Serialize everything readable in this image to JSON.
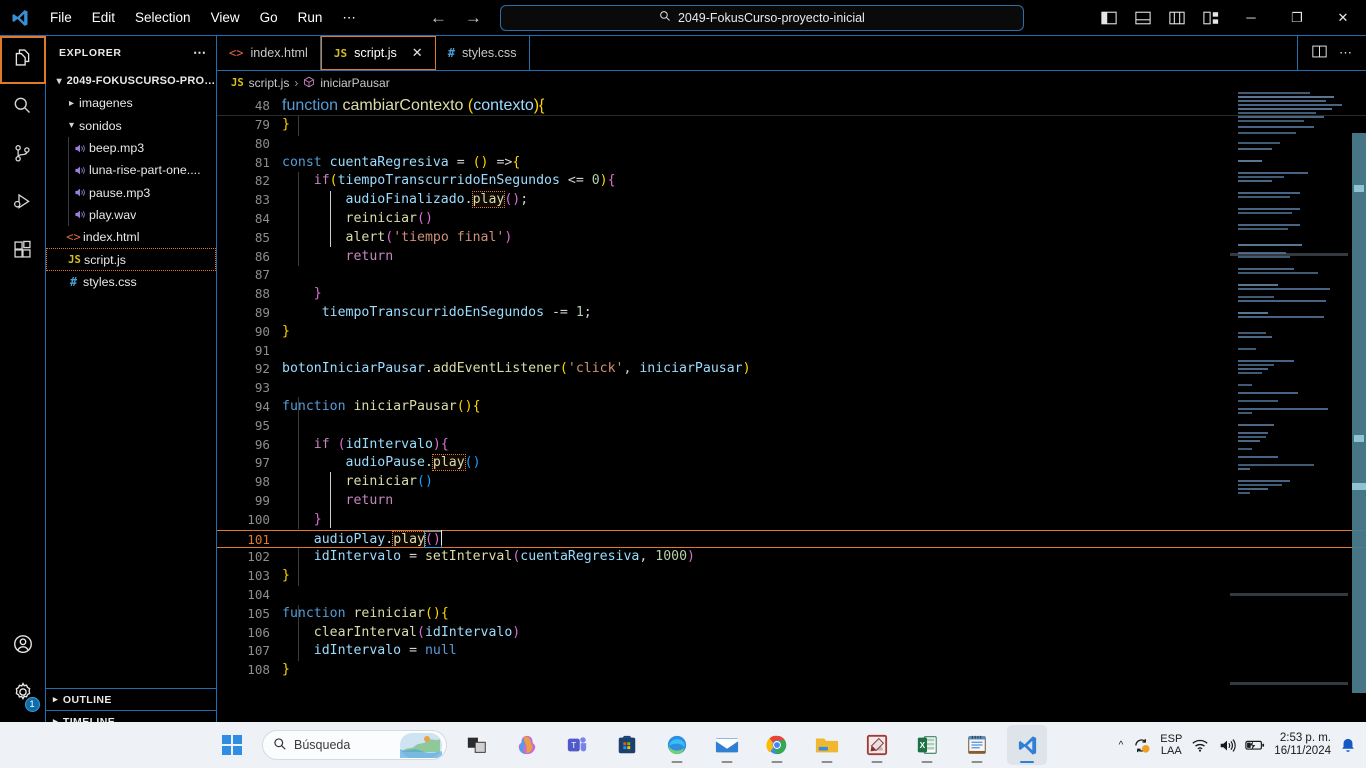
{
  "titlebar": {
    "logo_icon": "vscode-logo-icon",
    "menus": [
      "File",
      "Edit",
      "Selection",
      "View",
      "Go",
      "Run",
      "⋯"
    ],
    "nav_back_icon": "arrow-left-icon",
    "nav_forward_icon": "arrow-right-icon",
    "search": {
      "icon": "search-icon",
      "value": "2049-FokusCurso-proyecto-inicial"
    },
    "layout_buttons": [
      {
        "name": "toggle-primary-sidebar",
        "icon": "panel-left-icon"
      },
      {
        "name": "toggle-panel",
        "icon": "panel-bottom-icon"
      },
      {
        "name": "toggle-secondary-sidebar",
        "icon": "panel-right-icon"
      },
      {
        "name": "customize-layout",
        "icon": "layout-grid-icon"
      }
    ],
    "window_controls": {
      "minimize": "─",
      "restore": "❐",
      "close": "✕"
    }
  },
  "activitybar": {
    "items": [
      {
        "name": "explorer",
        "icon": "files-icon",
        "active": true
      },
      {
        "name": "search",
        "icon": "search-icon",
        "active": false
      },
      {
        "name": "source-control",
        "icon": "source-control-icon",
        "active": false
      },
      {
        "name": "run-and-debug",
        "icon": "run-debug-icon",
        "active": false
      },
      {
        "name": "extensions",
        "icon": "extensions-icon",
        "active": false
      }
    ],
    "bottom": [
      {
        "name": "accounts",
        "icon": "account-icon",
        "badge": ""
      },
      {
        "name": "manage-settings",
        "icon": "gear-icon",
        "badge": "1"
      }
    ]
  },
  "sidebar": {
    "title": "EXPLORER",
    "more_actions_icon": "ellipsis-icon",
    "root": {
      "label": "2049-FOKUSCURSO-PROY...",
      "expanded": true
    },
    "tree": [
      {
        "label": "imagenes",
        "icon": "folder-icon",
        "depth": 1,
        "kind": "folder",
        "expanded": false,
        "selected": false
      },
      {
        "label": "sonidos",
        "icon": "folder-icon",
        "depth": 1,
        "kind": "folder",
        "expanded": true,
        "selected": false
      },
      {
        "label": "beep.mp3",
        "icon": "audio-icon",
        "depth": 2,
        "kind": "file",
        "selected": false
      },
      {
        "label": "luna-rise-part-one....",
        "icon": "audio-icon",
        "depth": 2,
        "kind": "file",
        "selected": false
      },
      {
        "label": "pause.mp3",
        "icon": "audio-icon",
        "depth": 2,
        "kind": "file",
        "selected": false
      },
      {
        "label": "play.wav",
        "icon": "audio-icon",
        "depth": 2,
        "kind": "file",
        "selected": false
      },
      {
        "label": "index.html",
        "icon": "html-icon",
        "depth": 1,
        "kind": "file",
        "selected": false
      },
      {
        "label": "script.js",
        "icon": "js-icon",
        "depth": 1,
        "kind": "file",
        "selected": true
      },
      {
        "label": "styles.css",
        "icon": "css-icon",
        "depth": 1,
        "kind": "file",
        "selected": false
      }
    ],
    "sections": [
      {
        "label": "OUTLINE",
        "icon": "chevron-right-icon"
      },
      {
        "label": "TIMELINE",
        "icon": "chevron-right-icon"
      }
    ]
  },
  "editor": {
    "tabs": [
      {
        "label": "index.html",
        "icon": "html-icon",
        "active": false,
        "closable": false
      },
      {
        "label": "script.js",
        "icon": "js-icon",
        "active": true,
        "closable": true,
        "close_icon": "close-icon"
      },
      {
        "label": "styles.css",
        "icon": "css-icon",
        "active": false,
        "closable": false
      }
    ],
    "tab_actions": [
      {
        "name": "split-editor",
        "icon": "split-editor-icon"
      },
      {
        "name": "more-actions",
        "icon": "ellipsis-icon"
      }
    ],
    "breadcrumb": {
      "file_icon": "js-icon",
      "file": "script.js",
      "separator": "›",
      "symbol_icon": "symbol-method-icon",
      "symbol": "iniciarPausar"
    },
    "sticky_scroll": {
      "line": "48",
      "text": "function cambiarContexto (contexto){"
    },
    "current_line": 101,
    "first_visible_line": 78,
    "lines": [
      {
        "n": "79",
        "text": "}"
      },
      {
        "n": "80",
        "text": ""
      },
      {
        "n": "81",
        "text": "const cuentaRegresiva = () =>{"
      },
      {
        "n": "82",
        "text": "    if(tiempoTranscurridoEnSegundos <= 0){"
      },
      {
        "n": "83",
        "text": "        audioFinalizado.play();"
      },
      {
        "n": "84",
        "text": "        reiniciar()"
      },
      {
        "n": "85",
        "text": "        alert('tiempo final')"
      },
      {
        "n": "86",
        "text": "        return"
      },
      {
        "n": "87",
        "text": ""
      },
      {
        "n": "88",
        "text": "    }"
      },
      {
        "n": "89",
        "text": "     tiempoTranscurridoEnSegundos -= 1;"
      },
      {
        "n": "90",
        "text": "}"
      },
      {
        "n": "91",
        "text": ""
      },
      {
        "n": "92",
        "text": "botonIniciarPausar.addEventListener('click', iniciarPausar)"
      },
      {
        "n": "93",
        "text": ""
      },
      {
        "n": "94",
        "text": "function iniciarPausar(){"
      },
      {
        "n": "95",
        "text": ""
      },
      {
        "n": "96",
        "text": "    if (idIntervalo){"
      },
      {
        "n": "97",
        "text": "        audioPause.play()"
      },
      {
        "n": "98",
        "text": "        reiniciar()"
      },
      {
        "n": "99",
        "text": "        return"
      },
      {
        "n": "100",
        "text": "    }"
      },
      {
        "n": "101",
        "text": "    audioPlay.play()"
      },
      {
        "n": "102",
        "text": "    idIntervalo = setInterval(cuentaRegresiva, 1000)"
      },
      {
        "n": "103",
        "text": "}"
      },
      {
        "n": "104",
        "text": ""
      },
      {
        "n": "105",
        "text": "function reiniciar(){"
      },
      {
        "n": "106",
        "text": "    clearInterval(idIntervalo)"
      },
      {
        "n": "107",
        "text": "    idIntervalo = null"
      },
      {
        "n": "108",
        "text": "}"
      }
    ]
  },
  "taskbar": {
    "start_icon": "windows-start-icon",
    "search": {
      "icon": "search-icon",
      "placeholder": "Búsqueda",
      "widget_icon": "landscape-widget-icon"
    },
    "pinned": [
      {
        "name": "task-view",
        "icon": "task-view-icon",
        "running": false,
        "active": false
      },
      {
        "name": "copilot",
        "icon": "copilot-icon",
        "running": false,
        "active": false
      },
      {
        "name": "microsoft-teams",
        "icon": "teams-icon",
        "running": false,
        "active": false
      },
      {
        "name": "microsoft-store",
        "icon": "store-icon",
        "running": false,
        "active": false
      },
      {
        "name": "microsoft-edge",
        "icon": "edge-icon",
        "running": true,
        "active": false
      },
      {
        "name": "mail",
        "icon": "mail-icon",
        "running": true,
        "active": false
      },
      {
        "name": "google-chrome",
        "icon": "chrome-icon",
        "running": true,
        "active": false
      },
      {
        "name": "file-explorer",
        "icon": "file-explorer-icon",
        "running": true,
        "active": false
      },
      {
        "name": "photo-editor",
        "icon": "photo-editor-icon",
        "running": true,
        "active": false
      },
      {
        "name": "microsoft-excel",
        "icon": "excel-icon",
        "running": true,
        "active": false
      },
      {
        "name": "notepad",
        "icon": "notepad-icon",
        "running": true,
        "active": false
      },
      {
        "name": "visual-studio-code",
        "icon": "vscode-icon",
        "running": true,
        "active": true
      }
    ],
    "tray": {
      "overflow_icon": "chevron-up-icon",
      "sync_icon": "onedrive-sync-icon",
      "language": "ESP",
      "keyboard": "LAA",
      "wifi_icon": "wifi-icon",
      "volume_icon": "volume-icon",
      "battery_icon": "battery-charging-icon",
      "time": "2:53 p. m.",
      "date": "16/11/2024",
      "notifications_icon": "bell-icon"
    }
  },
  "colors": {
    "accent_orange": "#e07a29",
    "border_blue": "#1f6fb2",
    "editor_bg": "#000000",
    "taskbar_bg": "#eef1f5",
    "scrollbar": "#4a7c8c"
  }
}
